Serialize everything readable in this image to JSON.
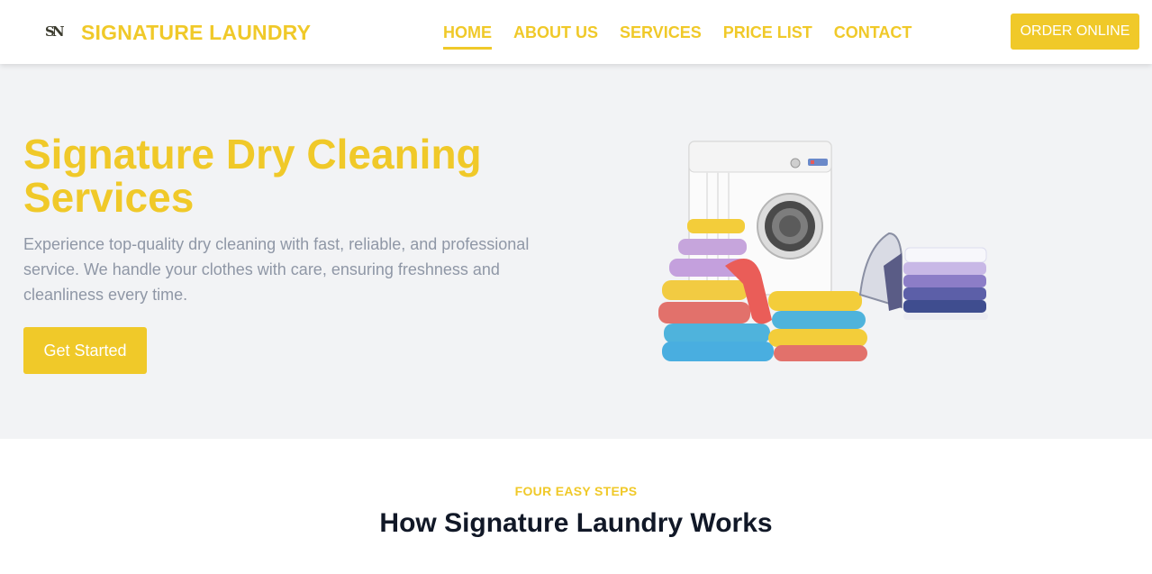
{
  "header": {
    "logo_mark": "SN",
    "brand": "SIGNATURE LAUNDRY",
    "nav": [
      {
        "label": "HOME",
        "active": true
      },
      {
        "label": "ABOUT US",
        "active": false
      },
      {
        "label": "SERVICES",
        "active": false
      },
      {
        "label": "PRICE LIST",
        "active": false
      },
      {
        "label": "CONTACT",
        "active": false
      }
    ],
    "order_button": "ORDER ONLINE"
  },
  "hero": {
    "title": "Signature Dry Cleaning Services",
    "description": "Experience top-quality dry cleaning with fast, reliable, and professional service. We handle your clothes with care, ensuring freshness and cleanliness every time.",
    "cta": "Get Started",
    "illustration": "washing-machine-with-folded-clothes-and-iron"
  },
  "steps": {
    "eyebrow": "FOUR EASY STEPS",
    "title": "How Signature Laundry Works"
  },
  "colors": {
    "accent": "#f0c929",
    "hero_bg": "#f2f3f5",
    "muted_text": "#8f97a6",
    "heading": "#111827"
  }
}
